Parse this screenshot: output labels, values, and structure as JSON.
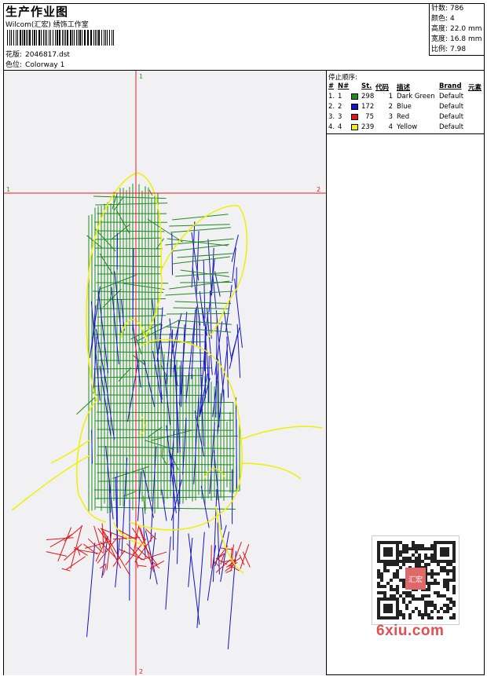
{
  "header": {
    "title": "生产作业图",
    "company": "Wilcom(汇宏) 绣饰工作室",
    "design_label": "花版:",
    "design_value": "2046817.dst",
    "colorway_label": "色位:",
    "colorway_value": "Colorway 1"
  },
  "specs": {
    "stitches_label": "针数:",
    "stitches": "786",
    "colors_label": "颜色:",
    "colors": "4",
    "height_label": "高度:",
    "height": "22.0 mm",
    "width_label": "宽度:",
    "width": "16.8 mm",
    "ratio_label": "比例:",
    "ratio": "7.98"
  },
  "guides": {
    "v_top": "1",
    "v_bottom": "2",
    "h_left": "1",
    "h_right": "2"
  },
  "legend": {
    "title": "停止顺序:",
    "headers": {
      "hash": "#",
      "num": "N#",
      "st": "St.",
      "code": "代码",
      "desc": "描述",
      "brand": "Brand",
      "elem": "元素"
    },
    "rows": [
      {
        "idx": "1.",
        "n": "1",
        "color": "#1e8a1e",
        "st": "298",
        "code": "1",
        "desc": "Dark Green",
        "brand": "Default"
      },
      {
        "idx": "2.",
        "n": "2",
        "color": "#1414c8",
        "st": "172",
        "code": "2",
        "desc": "Blue",
        "brand": "Default"
      },
      {
        "idx": "3.",
        "n": "3",
        "color": "#e01414",
        "st": "75",
        "code": "3",
        "desc": "Red",
        "brand": "Default"
      },
      {
        "idx": "4.",
        "n": "4",
        "color": "#f0f000",
        "st": "239",
        "code": "4",
        "desc": "Yellow",
        "brand": "Default"
      }
    ]
  },
  "watermark": {
    "site": "6xiu.com",
    "stamp": "汇宏"
  },
  "colors": {
    "guide": "#e02020",
    "green": "#1e8a1e",
    "blue": "#1414c8",
    "red": "#e01414",
    "yellow": "#f0f000"
  }
}
